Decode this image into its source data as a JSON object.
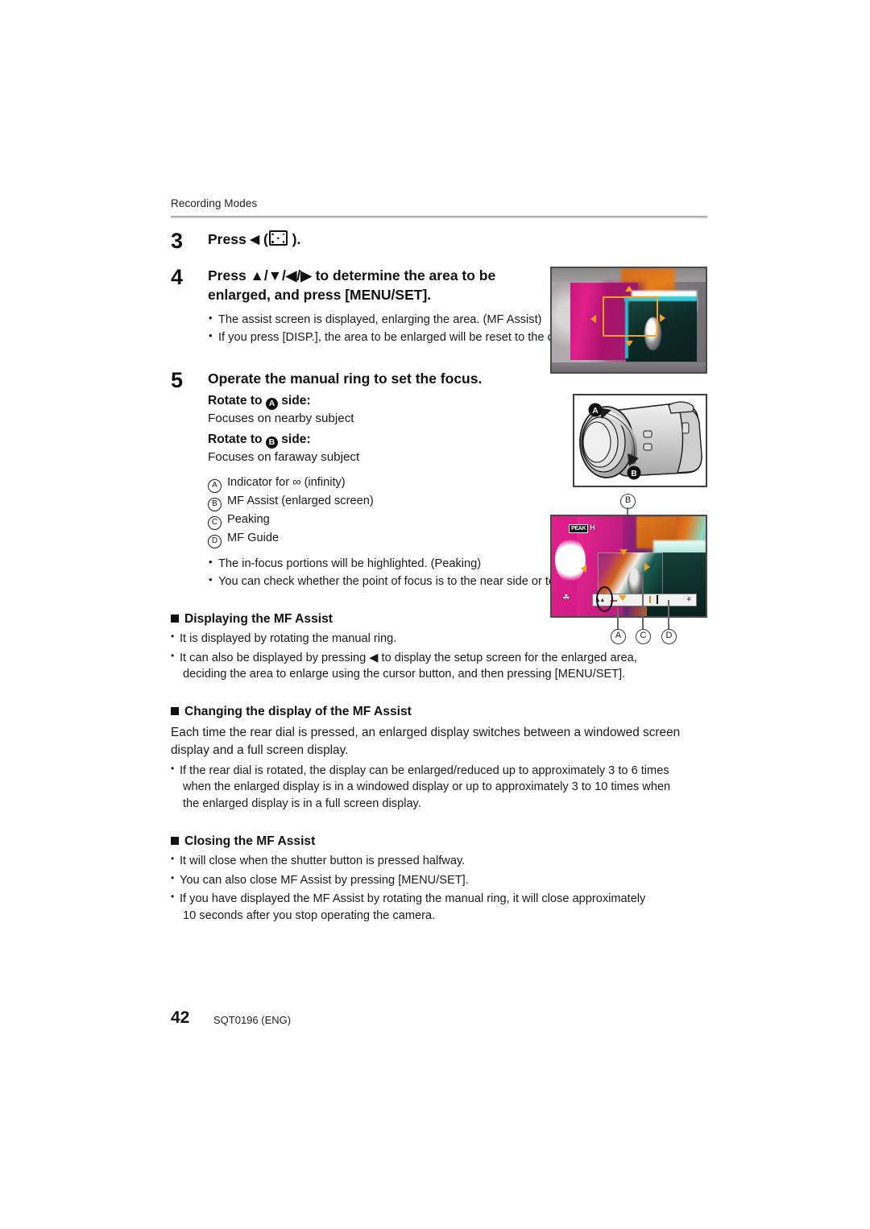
{
  "header": {
    "running_head": "Recording Modes"
  },
  "steps": [
    {
      "num": "3",
      "title_pre": "Press ",
      "title_arrow": "◀",
      "title_post": " (",
      "title_end": " ).",
      "icon": "af-area-icon"
    },
    {
      "num": "4",
      "title_line1_pre": "Press ",
      "arrows": "▲/▼/◀/▶",
      "title_line1_post": " to determine the area to be",
      "title_line2": "enlarged, and press [MENU/SET].",
      "bullets": [
        "The assist screen is displayed, enlarging the area. (MF Assist)",
        "If you press [DISP.], the area to be enlarged will be reset to the center."
      ]
    },
    {
      "num": "5",
      "title": "Operate the manual ring to set the focus.",
      "rotate_a_pre": "Rotate to ",
      "rotate_a_letter": "A",
      "rotate_a_post": " side:",
      "rotate_a_desc": "Focuses on nearby subject",
      "rotate_b_pre": "Rotate to ",
      "rotate_b_letter": "B",
      "rotate_b_post": " side:",
      "rotate_b_desc": "Focuses on faraway subject",
      "keys": [
        {
          "letter": "A",
          "text": "Indicator for ∞ (infinity)"
        },
        {
          "letter": "B",
          "text": "MF Assist (enlarged screen)"
        },
        {
          "letter": "C",
          "text": "Peaking"
        },
        {
          "letter": "D",
          "text": "MF Guide"
        }
      ],
      "bullets": [
        "The in-focus portions will be highlighted. (Peaking)",
        "You can check whether the point of focus is to the near side or to the far side. (MF Guide)"
      ]
    }
  ],
  "sections": [
    {
      "heading": "Displaying the MF Assist",
      "bullets": [
        {
          "line1": "It is displayed by rotating the manual ring."
        },
        {
          "line1": "It can also be displayed by pressing ◀ to display the setup screen for the enlarged area,",
          "line2": "deciding the area to enlarge using the cursor button, and then pressing [MENU/SET]."
        }
      ]
    },
    {
      "heading": "Changing the display of the MF Assist",
      "paragraph": "Each time the rear dial is pressed, an enlarged display switches between a windowed screen display and a full screen display.",
      "bullets": [
        {
          "line1": "If the rear dial is rotated, the display can be enlarged/reduced up to approximately 3 to 6 times",
          "line2": "when the enlarged display is in a windowed display or up to approximately 3 to 10 times when",
          "line3": "the enlarged display is in a full screen display."
        }
      ]
    },
    {
      "heading": "Closing the MF Assist",
      "bullets": [
        {
          "line1": "It will close when the shutter button is pressed halfway."
        },
        {
          "line1": "You can also close MF Assist by pressing [MENU/SET]."
        },
        {
          "line1": "If you have displayed the MF Assist by rotating the manual ring, it will close approximately",
          "line2": "10 seconds after you stop operating the camera."
        }
      ]
    }
  ],
  "figures": {
    "fig1": {
      "name": "enlargement-area-selection-screen",
      "selection_color": "#f5a01e"
    },
    "fig2": {
      "name": "camera-manual-ring-illustration",
      "label_a": "A",
      "label_b": "B"
    },
    "fig3": {
      "name": "mf-assist-screen",
      "peaking_badge": "PEAK",
      "peaking_level": "H",
      "callout_top": "B",
      "callout_a": "A",
      "callout_c": "C",
      "callout_d": "D"
    }
  },
  "footer": {
    "page_number": "42",
    "part_number": "SQT0196 (ENG)"
  }
}
